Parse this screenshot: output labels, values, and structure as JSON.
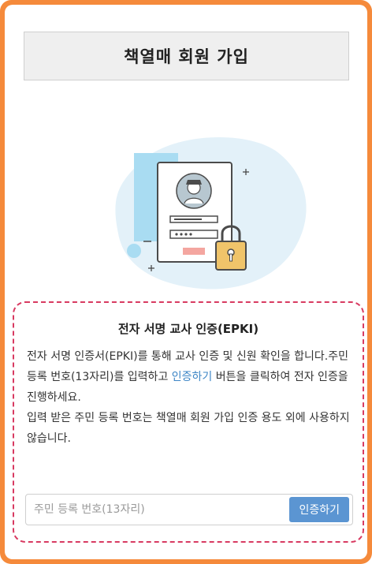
{
  "page": {
    "title": "책열매 회원 가입"
  },
  "auth": {
    "title": "전자 서명 교사 인증(EPKI)",
    "desc_line1_before_link": "전자 서명 인증서(EPKI)를 통해 교사 인증 및 신원 확인을 합니다.주민 등록 번호(13자리)를 입력하고 ",
    "desc_link": "인증하기",
    "desc_line1_after_link": " 버튼을 클릭하여 전자 인증을 진행하세요.",
    "desc_line2": "입력 받은 주민 등록 번호는 책열매 회원 가입 인증 용도 외에 사용하지 않습니다.",
    "input_placeholder": "주민 등록 번호(13자리)",
    "input_value": "",
    "button_label": "인증하기"
  },
  "colors": {
    "frame": "#f58a3b",
    "dashed_border": "#d83a61",
    "link": "#3d86c6",
    "button": "#5b95d2",
    "blob": "#e3f1f9",
    "avatar": "#b7c7d0",
    "lock": "#f0c46a"
  },
  "icons": {
    "illustration": "document-with-user-and-padlock",
    "lock": "padlock-icon"
  }
}
